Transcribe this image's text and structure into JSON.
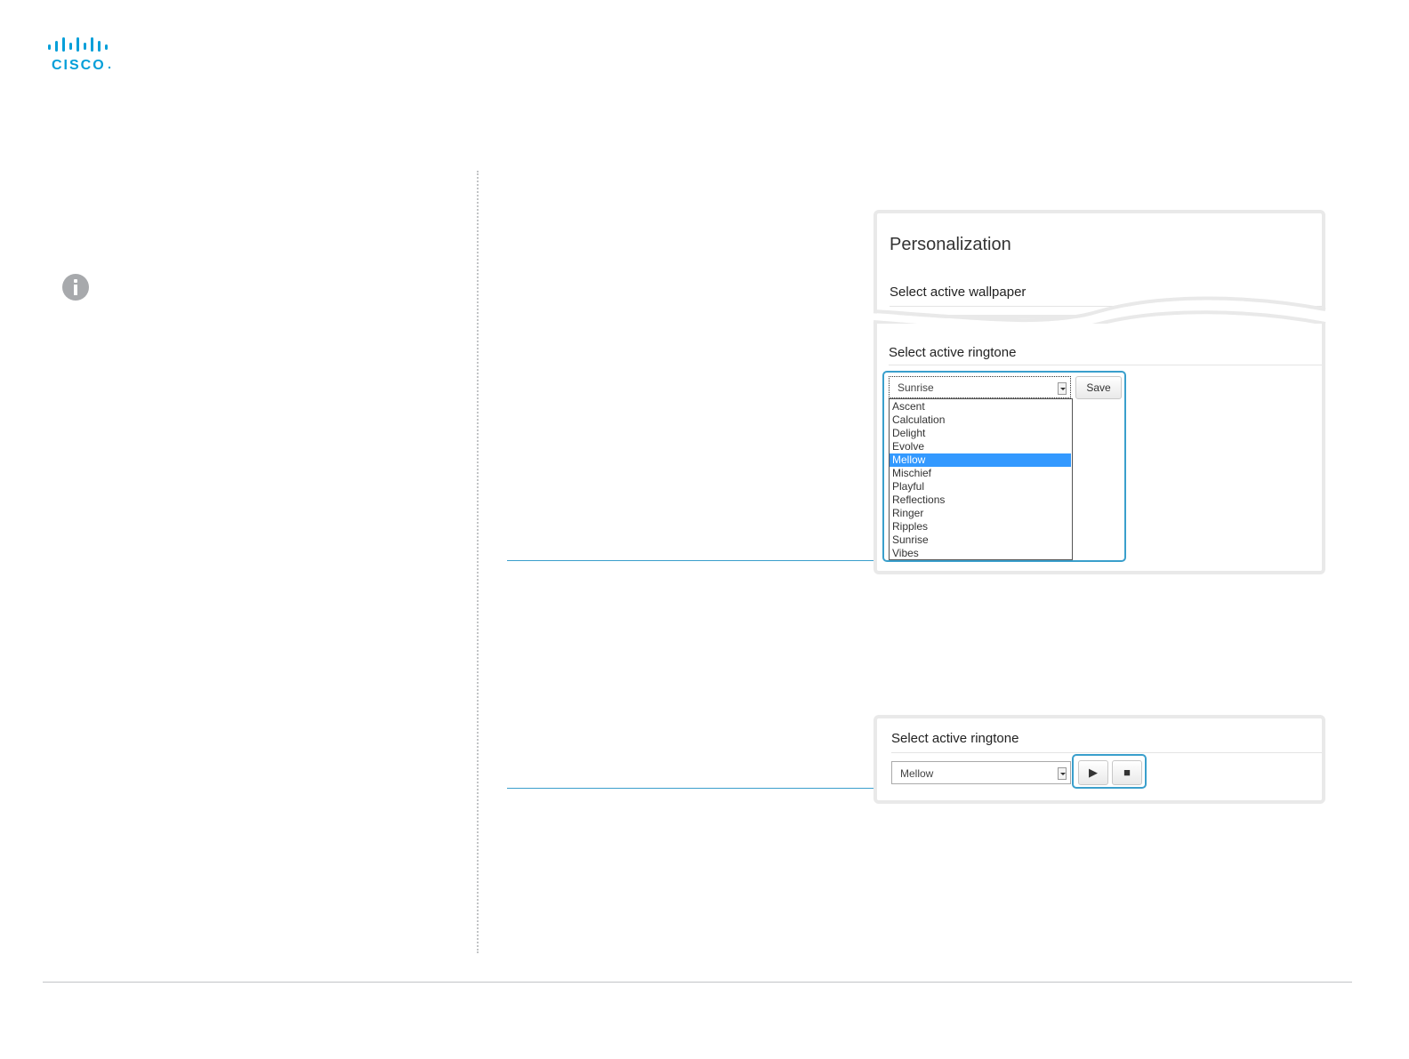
{
  "brand": {
    "logo_text": "CISCO",
    "color": "#049fd9"
  },
  "colors": {
    "highlight": "#3a9fcc",
    "selection": "#3399ff",
    "info_icon": "#a7a9ac"
  },
  "icons": {
    "info": "info-icon",
    "play": "play-icon",
    "stop": "stop-icon"
  },
  "top_screenshot": {
    "title": "Personalization",
    "wallpaper_label": "Select active wallpaper",
    "ringtone_label": "Select active ringtone",
    "ringtone_select_value": "Sunrise",
    "save_label": "Save",
    "options": [
      "Ascent",
      "Calculation",
      "Delight",
      "Evolve",
      "Mellow",
      "Mischief",
      "Playful",
      "Reflections",
      "Ringer",
      "Ripples",
      "Sunrise",
      "Vibes"
    ],
    "highlighted_option": "Mellow"
  },
  "bottom_screenshot": {
    "ringtone_label": "Select active ringtone",
    "ringtone_select_value": "Mellow",
    "play_glyph": "▶",
    "stop_glyph": "■"
  }
}
